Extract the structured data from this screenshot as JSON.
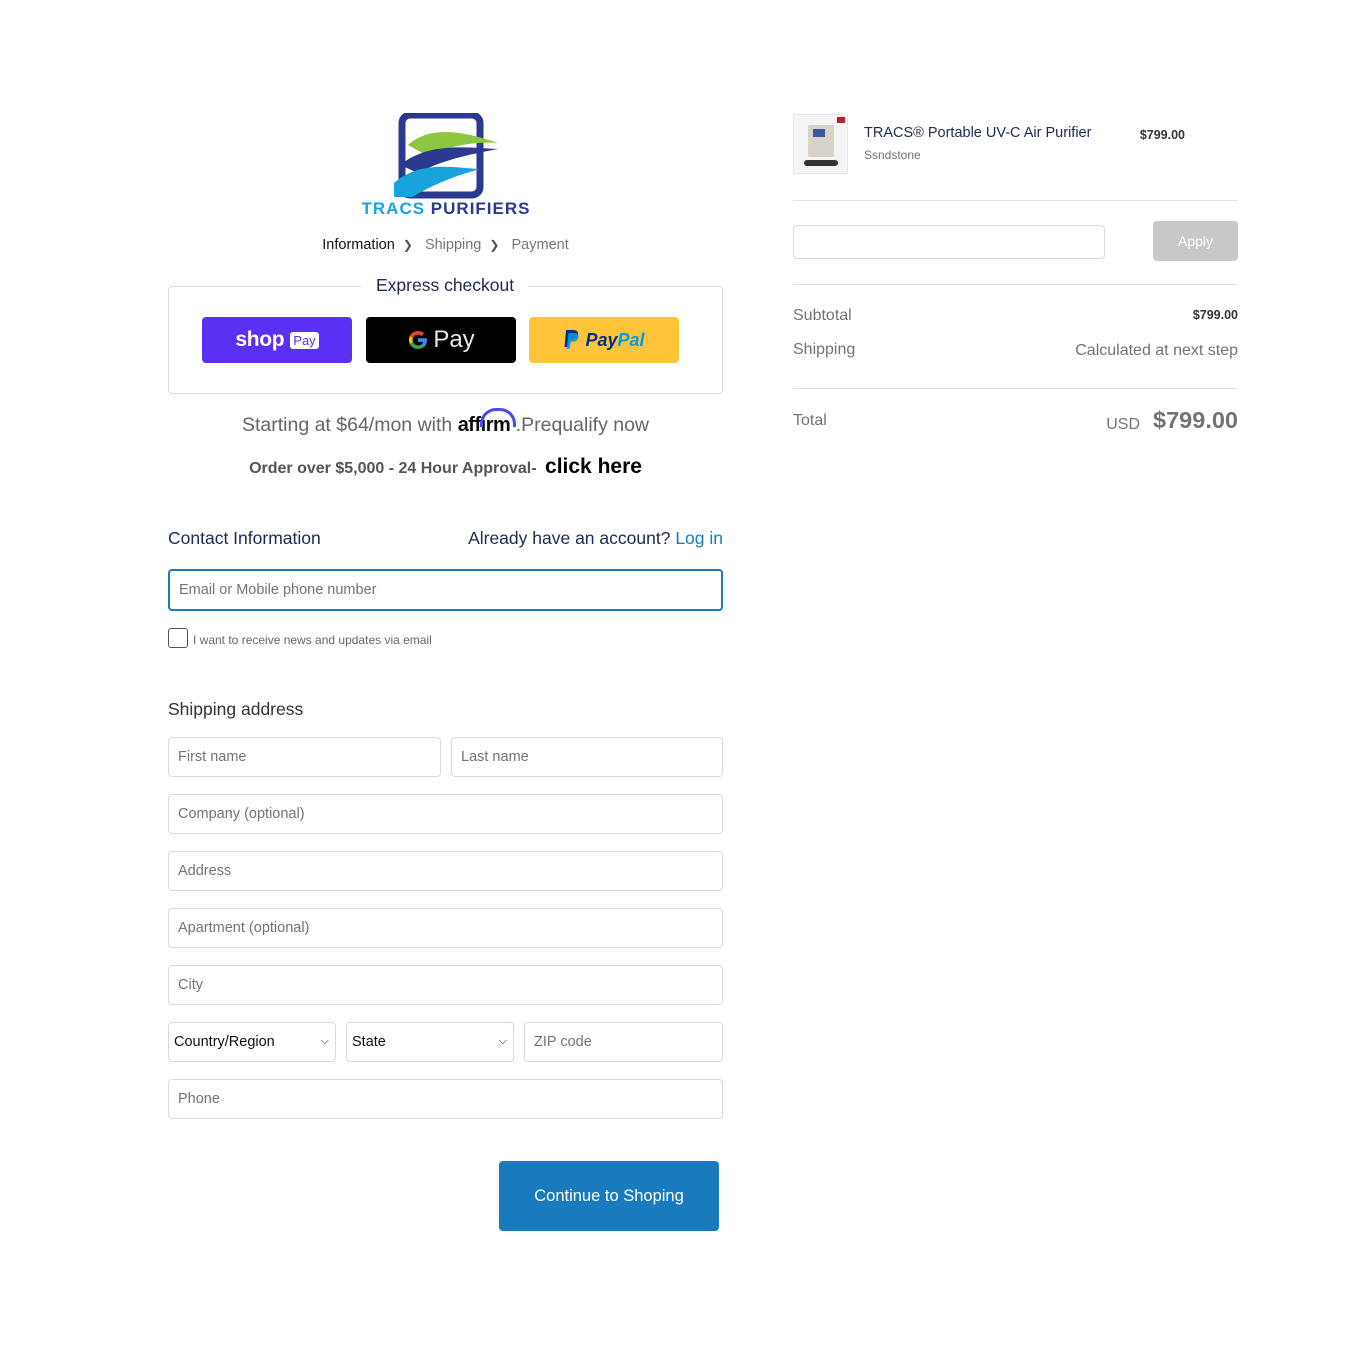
{
  "brand": {
    "name_part1": "TRACS",
    "name_part2": "PURIFIERS",
    "colors": {
      "blue": "#19a3dc",
      "navy": "#2b3a8e",
      "green": "#8dc63f"
    }
  },
  "breadcrumb": {
    "items": [
      {
        "label": "Information",
        "active": true
      },
      {
        "label": "Shipping",
        "active": false
      },
      {
        "label": "Payment",
        "active": false
      }
    ]
  },
  "express": {
    "title": "Express checkout",
    "shop_pay": {
      "word": "shop",
      "badge": "Pay"
    },
    "google_pay": {
      "word": "Pay"
    },
    "paypal": {
      "part1": "Pay",
      "part2": "Pal"
    }
  },
  "affirm": {
    "prefix": "Starting at $64/mon with",
    "logo": "affirm",
    "suffix": ".Prequalify now"
  },
  "order_promo": {
    "text": "Order over $5,000 - 24 Hour Approval-",
    "link": "click here"
  },
  "contact": {
    "title": "Contact Information",
    "account_prompt": "Already have an account?",
    "login_link": "Log in",
    "email_placeholder": "Email or Mobile phone number",
    "newsletter_label": "I want to receive news and updates via email"
  },
  "shipping_address": {
    "title": "Shipping address",
    "first_name_placeholder": "First name",
    "last_name_placeholder": "Last name",
    "company_placeholder": "Company (optional)",
    "address_placeholder": "Address",
    "apartment_placeholder": "Apartment (optional)",
    "city_placeholder": "City",
    "country_selected": "Country/Region",
    "state_selected": "State",
    "zip_placeholder": "ZIP code",
    "phone_placeholder": "Phone"
  },
  "continue_button": "Continue to Shoping",
  "order_summary": {
    "product": {
      "name": "TRACS® Portable UV-C Air Purifier",
      "variant": "Ssndstone",
      "price": "$799.00"
    },
    "discount": {
      "value": "",
      "apply_label": "Apply"
    },
    "subtotal_label": "Subtotal",
    "subtotal_value": "$799.00",
    "shipping_label": "Shipping",
    "shipping_value": "Calculated at next step",
    "total_label": "Total",
    "total_currency": "USD",
    "total_value": "$799.00"
  },
  "colors": {
    "accent": "#197bbd",
    "shop_pay": "#5a31f4",
    "paypal": "#ffc439"
  }
}
